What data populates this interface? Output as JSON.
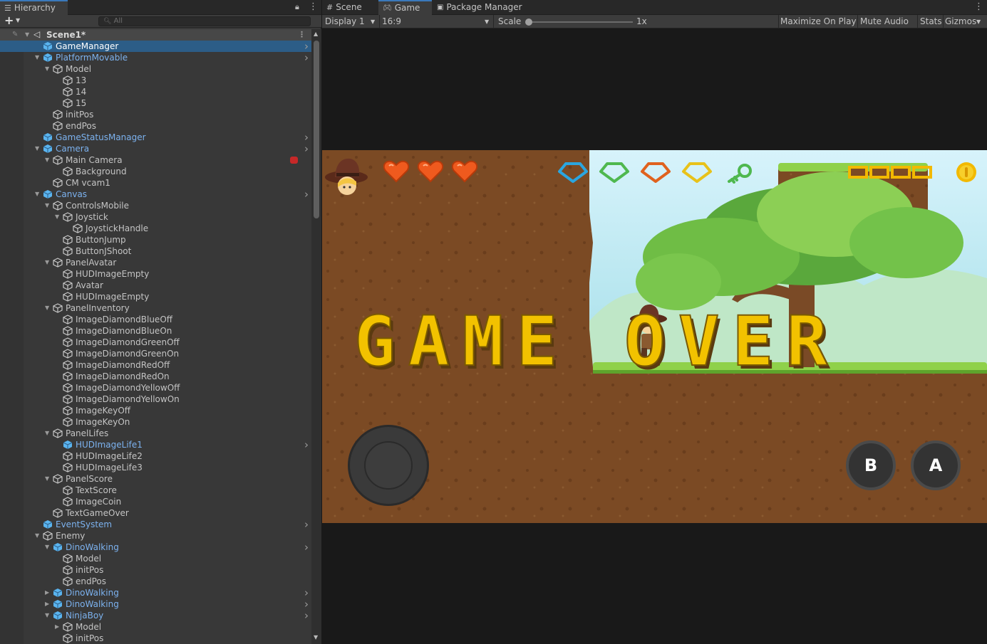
{
  "hierarchy": {
    "tab_label": "Hierarchy",
    "add_label": "+",
    "search_placeholder": "All",
    "scene_label": "Scene1*",
    "items": [
      {
        "label": "GameManager",
        "depth": 0,
        "arrow": "",
        "prefab": true,
        "selected": true,
        "more": true
      },
      {
        "label": "PlatformMovable",
        "depth": 0,
        "arrow": "down",
        "prefab": true,
        "more": true
      },
      {
        "label": "Model",
        "depth": 1,
        "arrow": "down",
        "prefab": false
      },
      {
        "label": "13",
        "depth": 2,
        "arrow": "",
        "prefab": false
      },
      {
        "label": "14",
        "depth": 2,
        "arrow": "",
        "prefab": false
      },
      {
        "label": "15",
        "depth": 2,
        "arrow": "",
        "prefab": false
      },
      {
        "label": "initPos",
        "depth": 1,
        "arrow": "",
        "prefab": false
      },
      {
        "label": "endPos",
        "depth": 1,
        "arrow": "",
        "prefab": false
      },
      {
        "label": "GameStatusManager",
        "depth": 0,
        "arrow": "",
        "prefab": true,
        "more": true
      },
      {
        "label": "Camera",
        "depth": 0,
        "arrow": "down",
        "prefab": true,
        "more": true
      },
      {
        "label": "Main Camera",
        "depth": 1,
        "arrow": "down",
        "prefab": false,
        "badge": true
      },
      {
        "label": "Background",
        "depth": 2,
        "arrow": "",
        "prefab": false
      },
      {
        "label": "CM vcam1",
        "depth": 1,
        "arrow": "",
        "prefab": false
      },
      {
        "label": "Canvas",
        "depth": 0,
        "arrow": "down",
        "prefab": true,
        "more": true
      },
      {
        "label": "ControlsMobile",
        "depth": 1,
        "arrow": "down",
        "prefab": false
      },
      {
        "label": "Joystick",
        "depth": 2,
        "arrow": "down",
        "prefab": false
      },
      {
        "label": "JoystickHandle",
        "depth": 3,
        "arrow": "",
        "prefab": false
      },
      {
        "label": "ButtonJump",
        "depth": 2,
        "arrow": "",
        "prefab": false
      },
      {
        "label": "ButtonJShoot",
        "depth": 2,
        "arrow": "",
        "prefab": false
      },
      {
        "label": "PanelAvatar",
        "depth": 1,
        "arrow": "down",
        "prefab": false
      },
      {
        "label": "HUDImageEmpty",
        "depth": 2,
        "arrow": "",
        "prefab": false
      },
      {
        "label": "Avatar",
        "depth": 2,
        "arrow": "",
        "prefab": false
      },
      {
        "label": "HUDImageEmpty",
        "depth": 2,
        "arrow": "",
        "prefab": false
      },
      {
        "label": "PanelInventory",
        "depth": 1,
        "arrow": "down",
        "prefab": false
      },
      {
        "label": "ImageDiamondBlueOff",
        "depth": 2,
        "arrow": "",
        "prefab": false
      },
      {
        "label": "ImageDiamondBlueOn",
        "depth": 2,
        "arrow": "",
        "prefab": false
      },
      {
        "label": "ImageDiamondGreenOff",
        "depth": 2,
        "arrow": "",
        "prefab": false
      },
      {
        "label": "ImageDiamondGreenOn",
        "depth": 2,
        "arrow": "",
        "prefab": false
      },
      {
        "label": "ImageDiamondRedOff",
        "depth": 2,
        "arrow": "",
        "prefab": false
      },
      {
        "label": "ImageDiamondRedOn",
        "depth": 2,
        "arrow": "",
        "prefab": false
      },
      {
        "label": "ImageDiamondYellowOff",
        "depth": 2,
        "arrow": "",
        "prefab": false
      },
      {
        "label": "ImageDiamondYellowOn",
        "depth": 2,
        "arrow": "",
        "prefab": false
      },
      {
        "label": "ImageKeyOff",
        "depth": 2,
        "arrow": "",
        "prefab": false
      },
      {
        "label": "ImageKeyOn",
        "depth": 2,
        "arrow": "",
        "prefab": false
      },
      {
        "label": "PanelLifes",
        "depth": 1,
        "arrow": "down",
        "prefab": false
      },
      {
        "label": "HUDImageLife1",
        "depth": 2,
        "arrow": "",
        "prefab": true,
        "more": true
      },
      {
        "label": "HUDImageLife2",
        "depth": 2,
        "arrow": "",
        "prefab": false
      },
      {
        "label": "HUDImageLife3",
        "depth": 2,
        "arrow": "",
        "prefab": false
      },
      {
        "label": "PanelScore",
        "depth": 1,
        "arrow": "down",
        "prefab": false
      },
      {
        "label": "TextScore",
        "depth": 2,
        "arrow": "",
        "prefab": false
      },
      {
        "label": "ImageCoin",
        "depth": 2,
        "arrow": "",
        "prefab": false
      },
      {
        "label": "TextGameOver",
        "depth": 1,
        "arrow": "",
        "prefab": false
      },
      {
        "label": "EventSystem",
        "depth": 0,
        "arrow": "",
        "prefab": true,
        "more": true
      },
      {
        "label": "Enemy",
        "depth": 0,
        "arrow": "down",
        "prefab": false,
        "plain": true
      },
      {
        "label": "DinoWalking",
        "depth": 1,
        "arrow": "down",
        "prefab": true,
        "more": true
      },
      {
        "label": "Model",
        "depth": 2,
        "arrow": "",
        "prefab": false
      },
      {
        "label": "initPos",
        "depth": 2,
        "arrow": "",
        "prefab": false
      },
      {
        "label": "endPos",
        "depth": 2,
        "arrow": "",
        "prefab": false
      },
      {
        "label": "DinoWalking",
        "depth": 1,
        "arrow": "right",
        "prefab": true,
        "more": true
      },
      {
        "label": "DinoWalking",
        "depth": 1,
        "arrow": "right",
        "prefab": true,
        "more": true
      },
      {
        "label": "NinjaBoy",
        "depth": 1,
        "arrow": "down",
        "prefab": true,
        "more": true
      },
      {
        "label": "Model",
        "depth": 2,
        "arrow": "right",
        "prefab": false
      },
      {
        "label": "initPos",
        "depth": 2,
        "arrow": "",
        "prefab": false
      }
    ]
  },
  "tabs": {
    "scene": "Scene",
    "game": "Game",
    "package_manager": "Package Manager"
  },
  "game_toolbar": {
    "display": "Display 1",
    "aspect": "16:9",
    "scale_label": "Scale",
    "scale_value": "1x",
    "maximize": "Maximize On Play",
    "mute": "Mute Audio",
    "stats": "Stats",
    "gizmos": "Gizmos"
  },
  "game_view": {
    "game_over_text": "GAME OVER",
    "button_b": "B",
    "button_a": "A",
    "lives": 3,
    "diamond_colors": [
      "#2aa6e0",
      "#4fb84f",
      "#e0621e",
      "#e8c21a"
    ],
    "score_boxes": 4
  }
}
